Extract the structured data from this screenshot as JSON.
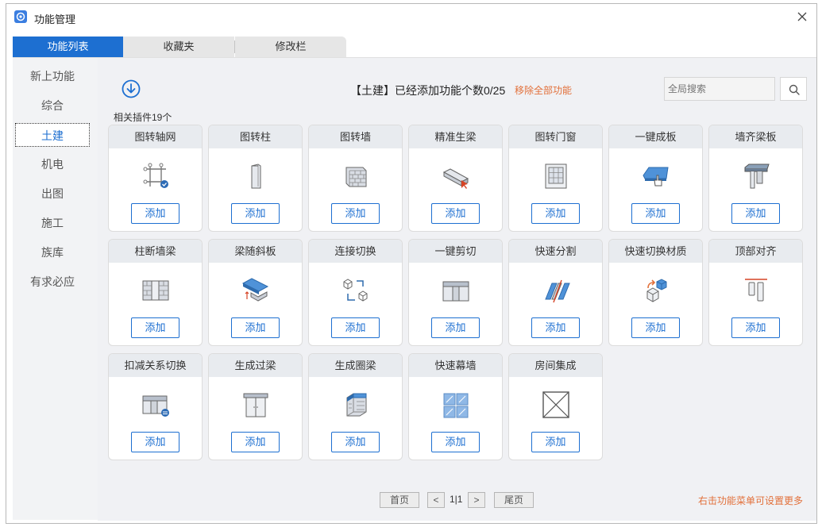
{
  "window": {
    "title": "功能管理"
  },
  "tabs": [
    {
      "label": "功能列表",
      "active": true
    },
    {
      "label": "收藏夹",
      "active": false
    },
    {
      "label": "修改栏",
      "active": false
    }
  ],
  "sidebar": {
    "items": [
      {
        "label": "新上功能"
      },
      {
        "label": "综合"
      },
      {
        "label": "土建",
        "active": true
      },
      {
        "label": "机电"
      },
      {
        "label": "出图"
      },
      {
        "label": "施工"
      },
      {
        "label": "族库"
      },
      {
        "label": "有求必应"
      }
    ]
  },
  "header": {
    "text": "【土建】已经添加功能个数0/25",
    "remove_all": "移除全部功能",
    "search_placeholder": "全局搜索",
    "plugin_count": "相关插件19个"
  },
  "cards": [
    {
      "title": "图转轴网",
      "icon": "axis-grid-icon",
      "button": "添加"
    },
    {
      "title": "图转柱",
      "icon": "column-icon",
      "button": "添加"
    },
    {
      "title": "图转墙",
      "icon": "brick-wall-icon",
      "button": "添加"
    },
    {
      "title": "精准生梁",
      "icon": "beam-icon",
      "button": "添加"
    },
    {
      "title": "图转门窗",
      "icon": "window-icon",
      "button": "添加"
    },
    {
      "title": "一键成板",
      "icon": "slab-icon",
      "button": "添加"
    },
    {
      "title": "墙齐梁板",
      "icon": "wall-align-slab-icon",
      "button": "添加"
    },
    {
      "title": "柱断墙梁",
      "icon": "column-cut-wall-icon",
      "button": "添加"
    },
    {
      "title": "梁随斜板",
      "icon": "beam-slope-icon",
      "button": "添加"
    },
    {
      "title": "连接切换",
      "icon": "connect-switch-icon",
      "button": "添加"
    },
    {
      "title": "一键剪切",
      "icon": "cut-icon",
      "button": "添加"
    },
    {
      "title": "快速分割",
      "icon": "split-icon",
      "button": "添加"
    },
    {
      "title": "快速切换材质",
      "icon": "material-switch-icon",
      "button": "添加"
    },
    {
      "title": "顶部对齐",
      "icon": "top-align-icon",
      "button": "添加"
    },
    {
      "title": "扣减关系切换",
      "icon": "deduction-switch-icon",
      "button": "添加"
    },
    {
      "title": "生成过梁",
      "icon": "lintel-icon",
      "button": "添加"
    },
    {
      "title": "生成圈梁",
      "icon": "ring-beam-icon",
      "button": "添加"
    },
    {
      "title": "快速幕墙",
      "icon": "curtain-wall-icon",
      "button": "添加"
    },
    {
      "title": "房间集成",
      "icon": "room-icon",
      "button": "添加"
    }
  ],
  "pager": {
    "first": "首页",
    "prev": "<",
    "page": "1|1",
    "next": ">",
    "last": "尾页"
  },
  "hint": "右击功能菜单可设置更多",
  "colors": {
    "accent": "#1d6fd1",
    "warning": "#e2703a"
  }
}
